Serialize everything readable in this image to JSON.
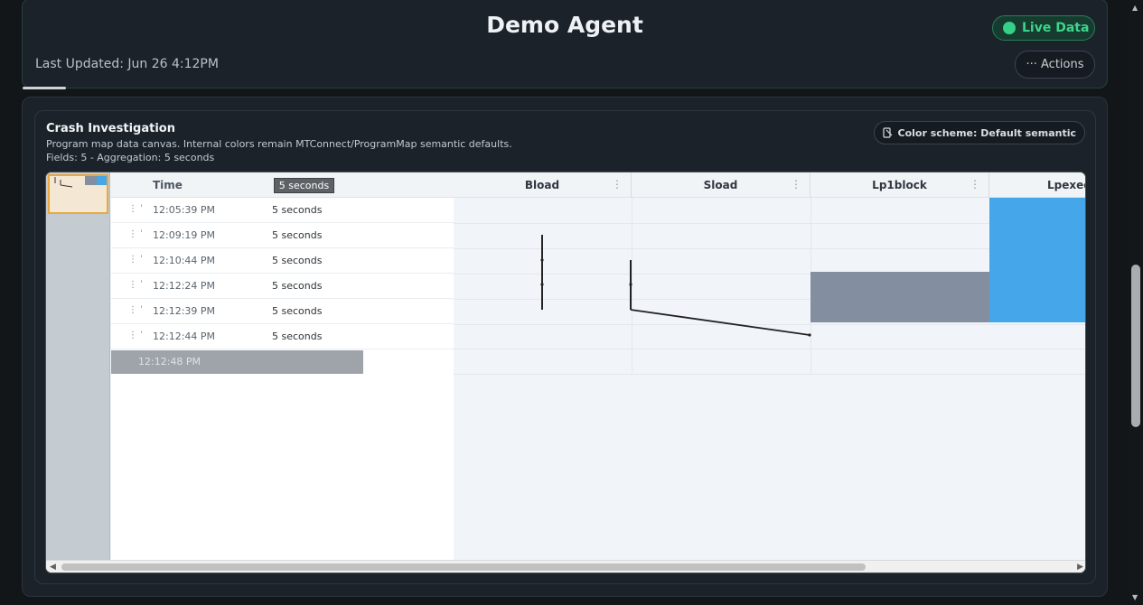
{
  "header": {
    "title": "Demo Agent",
    "last_updated": "Last Updated: Jun 26 4:12PM",
    "live_badge": "Live Data",
    "actions_label": "··· Actions"
  },
  "panel": {
    "title": "Crash Investigation",
    "description": "Program map data canvas. Internal colors remain MTConnect/ProgramMap semantic defaults.",
    "meta": "Fields: 5 - Aggregation: 5 seconds",
    "color_scheme_label": "Color scheme: Default semantic"
  },
  "grid": {
    "time_header": "Time",
    "aggregation_header": "5 seconds",
    "columns": [
      "Bload",
      "Sload",
      "Lp1block",
      "Lpexecu"
    ],
    "rows": [
      {
        "time": "12:05:39 PM",
        "agg": "5 seconds"
      },
      {
        "time": "12:09:19 PM",
        "agg": "5 seconds"
      },
      {
        "time": "12:10:44 PM",
        "agg": "5 seconds"
      },
      {
        "time": "12:12:24 PM",
        "agg": "5 seconds"
      },
      {
        "time": "12:12:39 PM",
        "agg": "5 seconds"
      },
      {
        "time": "12:12:44 PM",
        "agg": "5 seconds"
      }
    ],
    "pending_row_time": "12:12:48 PM"
  },
  "colors": {
    "live": "#35d186",
    "lp1block_fill": "#838fa1",
    "lpexecu_fill": "#45a7ea",
    "selection_border": "#e8a83e"
  },
  "icons": [
    "ellipsis-icon",
    "color-scheme-icon",
    "drag-handle-icon",
    "column-menu-icon"
  ]
}
